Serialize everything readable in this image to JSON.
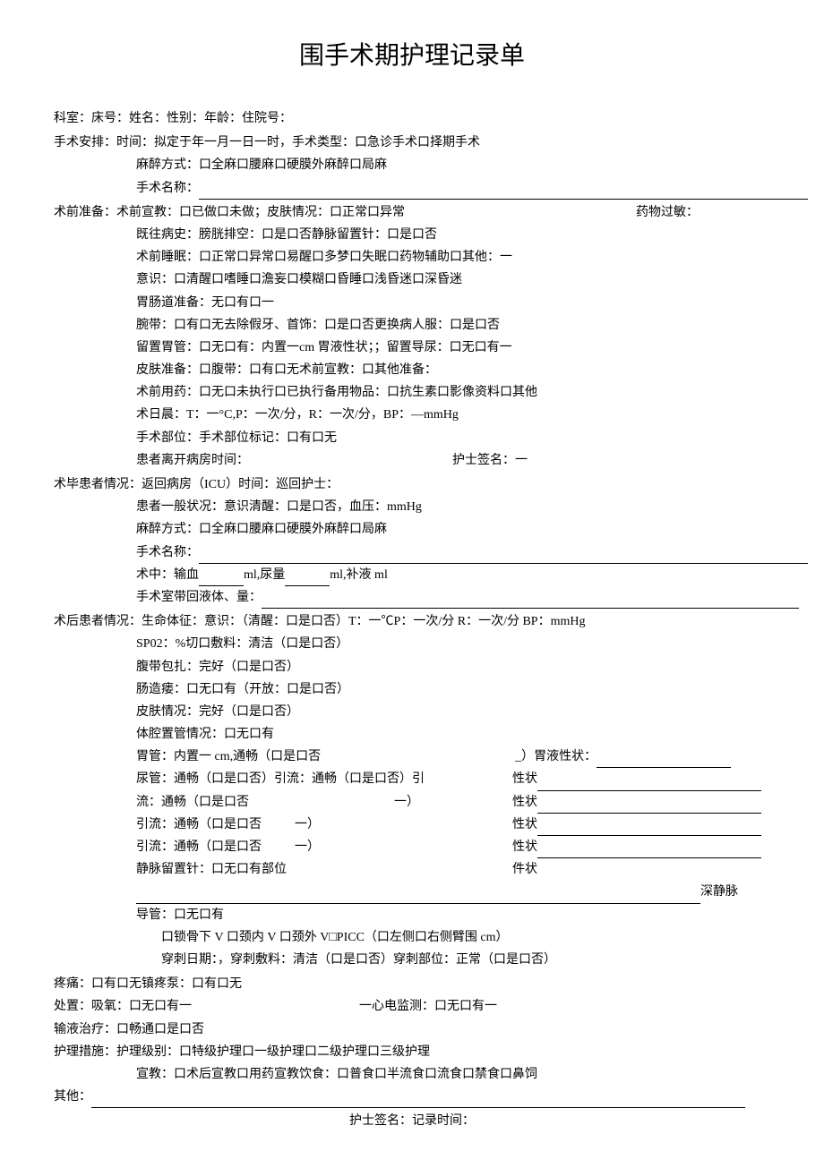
{
  "title": "围手术期护理记录单",
  "header": {
    "dept_bed": "科室：床号：姓名：性别：年龄：住院号："
  },
  "surgery_arrange": {
    "label": "手术安排：",
    "time": "时间：拟定于年一月一日一时，手术类型：口急诊手术口择期手术",
    "anesthesia": "麻醉方式：口全麻口腰麻口硬膜外麻醉口局麻",
    "surgery_name": "手术名称："
  },
  "preop": {
    "label": "术前准备：",
    "edu": "术前宣教：口已做口未做；皮肤情况：口正常口异常",
    "allergy": "药物过敏：",
    "history": "既往病史：膀胱排空：口是口否静脉留置针：口是口否",
    "sleep": "术前睡眠：口正常口异常口易醒口多梦口失眠口药物辅助口其他：一",
    "consciousness": "意识：口清醒口嗜睡口澹妄口模糊口昏睡口浅昏迷口深昏迷",
    "gi_prep": "胃肠道准备：无口有口一",
    "wristband": "腕带：口有口无去除假牙、首饰：口是口否更换病人服：口是口否",
    "gastric": "留置胃管：口无口有：内置一cm 胃液性状；；留置导尿：口无口有一",
    "skin_prep": "皮肤准备：口腹带：口有口无术前宣教：口其他准备：",
    "preop_med": "术前用药：口无口未执行口已执行备用物品：口抗生素口影像资料口其他",
    "morning": "术日晨：T：一°C,P：一次/分，R：一次/分，BP：—mmHg",
    "body_part": "手术部位：手术部位标记：口有口无",
    "leave_time": "患者离开病房时间：",
    "nurse_sig": "护士签名：一"
  },
  "postop_return": {
    "label": "术毕患者情况：",
    "return": "返回病房（ICU）时间：巡回护士：",
    "general": "患者一般状况：意识清醒：口是口否，血压：mmHg",
    "anesthesia": "麻醉方式：口全麻口腰麻口硬膜外麻醉口局麻",
    "surgery_name": "手术名称：",
    "intraop": "术中：输血",
    "intraop2": "ml,尿量",
    "intraop3": "ml,补液 ml",
    "return_fluid": "手术室带回液体、量："
  },
  "postop_status": {
    "label": "术后患者情况：",
    "vitals": "生命体征：意识：（清醒：口是口否）T：一℃P：一次/分 R：一次/分 BP：mmHg",
    "spo2": "SP02：%切口敷料：清洁（口是口否）",
    "abdominal": "腹带包扎：完好（口是口否）",
    "stoma": "肠造瘘：口无口有（开放：口是口否）",
    "skin": "皮肤情况：完好（口是口否）",
    "cavity_tube": "体腔置管情况：口无口有",
    "gastric": "胃管：内置一 cm,通畅（口是口否",
    "gastric_prop": "_）胃液性状：",
    "urinary": "尿管：通畅（口是口否）引流：通畅（口是口否）引",
    "drain1": "流：通畅（口是口否",
    "drain1_end": "一）",
    "drain2": "引流：通畅（口是口否",
    "drain2_end": "一）",
    "drain3": "引流：通畅（口是口否",
    "drain3_end": "一）",
    "iv": "静脉留置针：口无口有部位",
    "property": "性状",
    "stat": "件状",
    "deep_vein": "深静脉",
    "catheter": "导管：口无口有",
    "clavicle": "口锁骨下 V 口颈内 V 口颈外 V□PICC（口左侧口右侧臂围 cm）",
    "puncture": "穿刺日期：，穿刺敷料：清洁（口是口否）穿刺部位：正常（口是口否）"
  },
  "pain": "疼痛：口有口无镇疼泵：口有口无",
  "treatment": {
    "oxygen": "处置：吸氧：口无口有一",
    "ecg": "一心电监测：口无口有一"
  },
  "infusion": "输液治疗：口畅通口是口否",
  "nursing": {
    "label": "护理措施：",
    "level": "护理级别：口特级护理口一级护理口二级护理口三级护理",
    "edu": "宣教：口术后宣教口用药宣教饮食：口普食口半流食口流食口禁食口鼻饲"
  },
  "other": "其他：",
  "footer": "护士签名：记录时间："
}
